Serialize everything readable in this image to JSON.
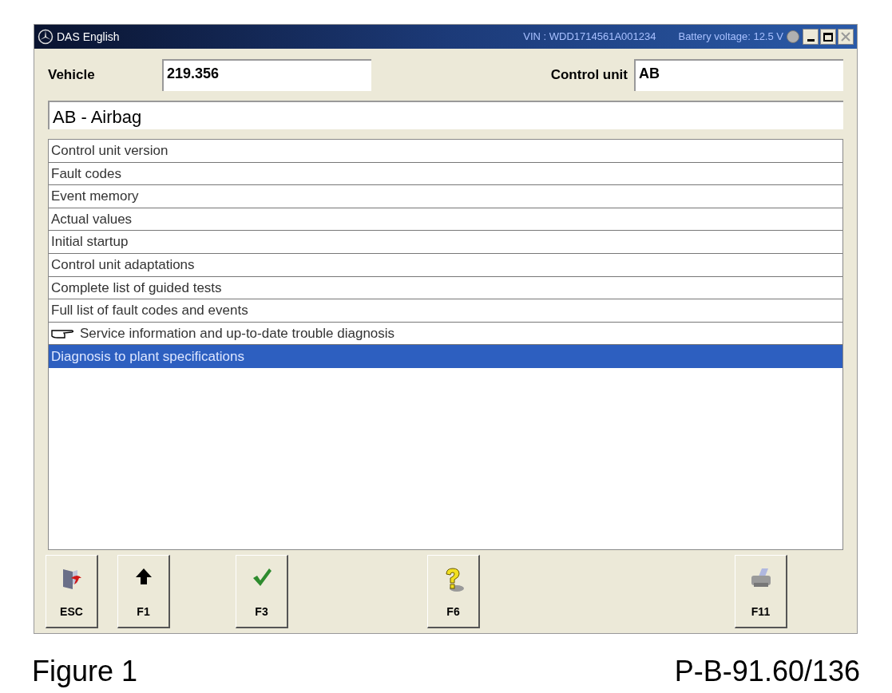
{
  "window": {
    "title": "DAS English",
    "vin": "VIN : WDD1714561A001234",
    "battery": "Battery voltage: 12.5 V"
  },
  "vehicle": {
    "label": "Vehicle",
    "value": "219.356"
  },
  "control_unit": {
    "label": "Control unit",
    "value": "AB"
  },
  "description": "AB - Airbag",
  "menu_items": [
    {
      "label": "Control unit version",
      "kind": "plain",
      "selected": false
    },
    {
      "label": "Fault codes",
      "kind": "plain",
      "selected": false
    },
    {
      "label": "Event memory",
      "kind": "plain",
      "selected": false
    },
    {
      "label": "Actual values",
      "kind": "plain",
      "selected": false
    },
    {
      "label": "Initial startup",
      "kind": "plain",
      "selected": false
    },
    {
      "label": "Control unit adaptations",
      "kind": "plain",
      "selected": false
    },
    {
      "label": "Complete list of guided tests",
      "kind": "plain",
      "selected": false
    },
    {
      "label": "Full list of fault codes and events",
      "kind": "plain",
      "selected": false
    },
    {
      "label": "Service information and up-to-date trouble diagnosis",
      "kind": "pointer",
      "selected": false
    },
    {
      "label": "Diagnosis to plant specifications",
      "kind": "plain",
      "selected": true
    }
  ],
  "toolbar": [
    {
      "key": "ESC",
      "kind": "exit"
    },
    {
      "key": "F1",
      "kind": "up"
    },
    {
      "key": "F3",
      "kind": "check"
    },
    {
      "key": "F6",
      "kind": "help"
    },
    {
      "key": "F11",
      "kind": "print"
    }
  ],
  "caption": {
    "figure": "Figure 1",
    "reference": "P-B-91.60/136"
  }
}
